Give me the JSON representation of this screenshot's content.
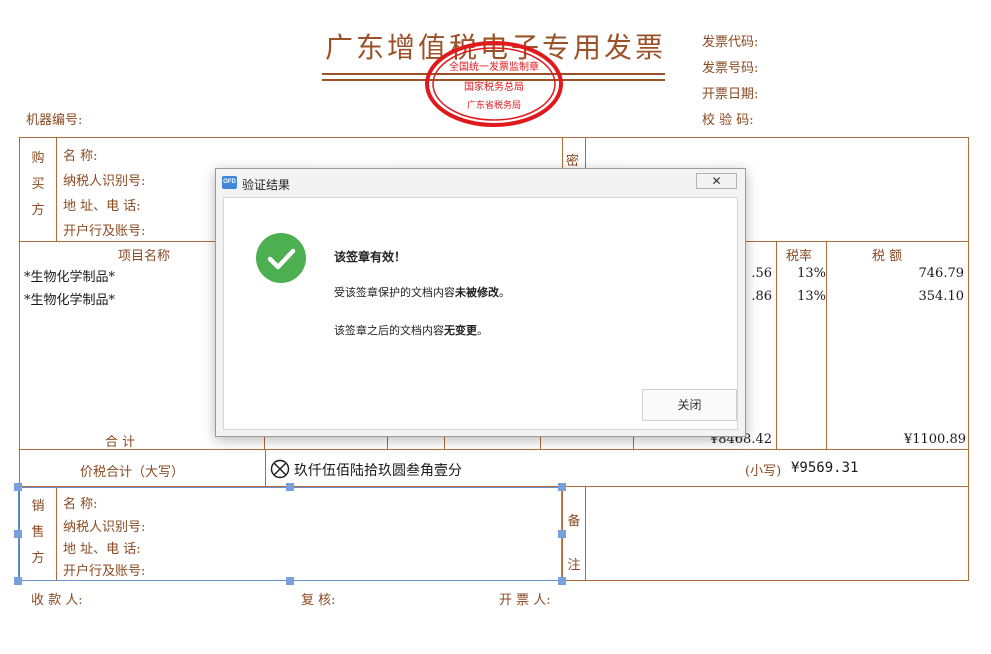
{
  "invoice": {
    "title": "广东增值税电子专用发票",
    "seal_text_top": "全国统一发票监制章",
    "seal_text_mid": "国家税务总局",
    "seal_text_bottom": "广东省税务局",
    "meta": {
      "code_label": "发票代码:",
      "number_label": "发票号码:",
      "date_label": "开票日期:",
      "check_label": "校 验 码:"
    },
    "machine_no_label": "机器编号:",
    "buyer": {
      "side_label": [
        "购",
        "买",
        "方"
      ],
      "name_label": "名        称:",
      "taxid_label": "纳税人识别号:",
      "addr_label": "地 址、电 话:",
      "bank_label": "开户行及账号:",
      "password_side_label": "密"
    },
    "items": {
      "header_name": "项目名称",
      "header_rate": "税率",
      "header_tax": "税    额",
      "rows": [
        {
          "name": "*生物化学制品*",
          "amount_tail": ".56",
          "rate": "13%",
          "tax": "746.79"
        },
        {
          "name": "*生物化学制品*",
          "amount_tail": ".86",
          "rate": "13%",
          "tax": "354.10"
        }
      ],
      "total_label": "合        计",
      "total_amount": "¥8468.42",
      "total_tax": "¥1100.89"
    },
    "price_tax_total": {
      "label": "价税合计（大写）",
      "uppercase": "玖仟伍佰陆拾玖圆叁角壹分",
      "lowercase_label": "(小写)",
      "lowercase_value": "¥9569.31"
    },
    "seller": {
      "side_label": [
        "销",
        "售",
        "方"
      ],
      "name_label": "名        称:",
      "taxid_label": "纳税人识别号:",
      "addr_label": "地 址、电 话:",
      "bank_label": "开户行及账号:",
      "remark_label": [
        "备",
        "注"
      ]
    },
    "footer": {
      "payee_label": "收 款 人:",
      "reviewer_label": "复    核:",
      "drawer_label": "开 票 人:"
    }
  },
  "dialog": {
    "app_icon_text": "OFD",
    "title": "验证结果",
    "close_glyph": "✕",
    "heading": "该签章有效！",
    "line1_prefix": "受该签章保护的文档内容",
    "line1_bold": "未被修改",
    "line1_suffix": "。",
    "line2_prefix": "该签章之后的文档内容",
    "line2_bold": "无变更",
    "line2_suffix": "。",
    "button_label": "关闭"
  },
  "colors": {
    "invoice_brown": "#8a4a22",
    "seal_red": "#e0191c",
    "success_green": "#4caf50",
    "selection_blue": "#6a8fd0"
  }
}
